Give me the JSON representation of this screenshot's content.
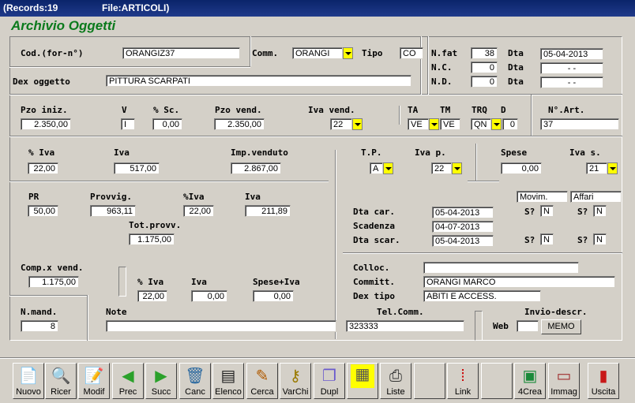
{
  "titlebar": {
    "records": "(Records:19",
    "file": "File:ARTICOLI)"
  },
  "app_title": "Archivio Oggetti",
  "labels": {
    "cod": "Cod.(for-n°)",
    "comm": "Comm.",
    "tipo": "Tipo",
    "nfat": "N.fat",
    "dta": "Dta",
    "nc": "N.C.",
    "nd": "N.D.",
    "dex_oggetto": "Dex oggetto",
    "pzo_iniz": "Pzo iniz.",
    "v": "V",
    "sc": "% Sc.",
    "pzo_vend": "Pzo vend.",
    "iva_vend": "Iva vend.",
    "ta": "TA",
    "tm": "TM",
    "trq": "TRQ",
    "d": "D",
    "nart": "N°.Art.",
    "piva": "% Iva",
    "iva": "Iva",
    "imp_venduto": "Imp.venduto",
    "tp": "T.P.",
    "iva_p": "Iva p.",
    "spese": "Spese",
    "iva_s": "Iva s.",
    "pr": "PR",
    "provvig": "Provvig.",
    "piva2": "%Iva",
    "iva2": "Iva",
    "tot_provv": "Tot.provv.",
    "dta_car": "Dta car.",
    "scadenza": "Scadenza",
    "dta_scar": "Dta scar.",
    "s1": "S?",
    "s2": "S?",
    "s3": "S?",
    "s4": "S?",
    "comp_vend": "Comp.x vend.",
    "piva3": "% Iva",
    "iva3": "Iva",
    "spese_iva": "Spese+Iva",
    "colloc": "Colloc.",
    "committ": "Committ.",
    "dex_tipo": "Dex tipo",
    "nmand": "N.mand.",
    "note": "Note",
    "tel_comm": "Tel.Comm.",
    "invio": "Invio-descr.",
    "web": "Web"
  },
  "fields": {
    "cod": "ORANGIZ37",
    "comm": "ORANGI",
    "tipo": "CO",
    "nfat": "38",
    "dta1": "05-04-2013",
    "nc": "0",
    "dta2": "-  -",
    "nd": "0",
    "dta3": "-  -",
    "dex_oggetto": "PITTURA SCARPATI",
    "pzo_iniz": "2.350,00",
    "v": "I",
    "sc": "0,00",
    "pzo_vend": "2.350,00",
    "iva_vend": "22",
    "ta": "VE",
    "tm": "VE",
    "trq": "QN",
    "d": "0",
    "nart": "37",
    "piva": "22,00",
    "iva": "517,00",
    "imp_venduto": "2.867,00",
    "tp": "A",
    "iva_p": "22",
    "spese": "0,00",
    "iva_s": "21",
    "movim": "Movim.",
    "affari": "Affari",
    "pr": "50,00",
    "provvig": "963,11",
    "piva2": "22,00",
    "iva2": "211,89",
    "tot_provv": "1.175,00",
    "dta_car": "05-04-2013",
    "scadenza": "04-07-2013",
    "dta_scar": "05-04-2013",
    "s1": "N",
    "s2": "N",
    "s3": "N",
    "s4": "N",
    "comp_vend": "1.175,00",
    "piva3": "22,00",
    "iva3": "0,00",
    "spese_iva": "0,00",
    "colloc": "",
    "committ": "ORANGI MARCO",
    "dex_tipo": "ABITI E ACCESS.",
    "nmand": "8",
    "note": "",
    "tel_comm": "323333",
    "web": "",
    "memo": "MEMO"
  },
  "toolbar": [
    {
      "label": "Nuovo",
      "icon": "new-doc-icon"
    },
    {
      "label": "Ricer",
      "icon": "magnifier-icon"
    },
    {
      "label": "Modif",
      "icon": "edit-doc-icon"
    },
    {
      "label": "Prec",
      "icon": "arrow-left-icon"
    },
    {
      "label": "Succ",
      "icon": "arrow-right-icon"
    },
    {
      "label": "Canc",
      "icon": "trash-icon"
    },
    {
      "label": "Elenco",
      "icon": "list-icon"
    },
    {
      "label": "Cerca",
      "icon": "search-brush-icon"
    },
    {
      "label": "VarChi",
      "icon": "keys-icon"
    },
    {
      "label": "Dupl",
      "icon": "copy-icon"
    },
    {
      "label": "",
      "icon": "grid-icon"
    },
    {
      "label": "Liste",
      "icon": "printer-icon"
    },
    {
      "label": "",
      "icon": "blank-icon"
    },
    {
      "label": "Link",
      "icon": "link-icon"
    },
    {
      "label": "",
      "icon": "blank-icon"
    },
    {
      "label": "4Crea",
      "icon": "create-icon"
    },
    {
      "label": "Immag",
      "icon": "image-card-icon"
    },
    {
      "label": "Uscita",
      "icon": "exit-door-icon"
    }
  ],
  "colors": {
    "title_green": "#0b7a1c",
    "dropdown_yellow": "#ffff00",
    "titlebar_blue": "#0a246a"
  }
}
